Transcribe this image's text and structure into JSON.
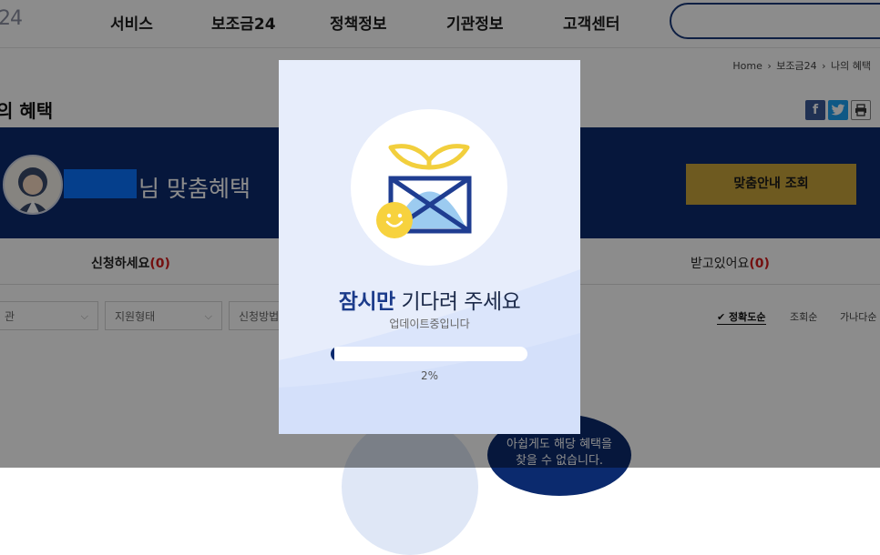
{
  "header": {
    "logo_fragment": "24",
    "nav": [
      "서비스",
      "보조금24",
      "정책정보",
      "기관정보",
      "고객센터"
    ]
  },
  "breadcrumb": [
    "Home",
    "보조금24",
    "나의 혜택"
  ],
  "page": {
    "title": "의 혜택"
  },
  "banner": {
    "greeting": "님 맞춤혜택",
    "consult_button": "맞춤안내 조회"
  },
  "tabs": [
    {
      "label": "신청하세요",
      "count": "(0)"
    },
    {
      "label": "받고있어요",
      "count": "(0)"
    }
  ],
  "filters": [
    "관",
    "지원형태",
    "신청방법"
  ],
  "sort": [
    "정확도순",
    "조회순",
    "가나다순"
  ],
  "empty": {
    "line1": "아쉽게도 해당 혜택을",
    "line2": "찾을 수 없습니다."
  },
  "modal": {
    "title_bold": "잠시만",
    "title_rest": " 기다려 주세요",
    "subtitle": "업데이트중입니다",
    "progress_percent": 2,
    "progress_text": "2%"
  },
  "colors": {
    "navy": "#0b2a6e",
    "gold": "#c9a43b",
    "modal_bg": "#e7edfb",
    "accent_red": "#d31c1c"
  }
}
